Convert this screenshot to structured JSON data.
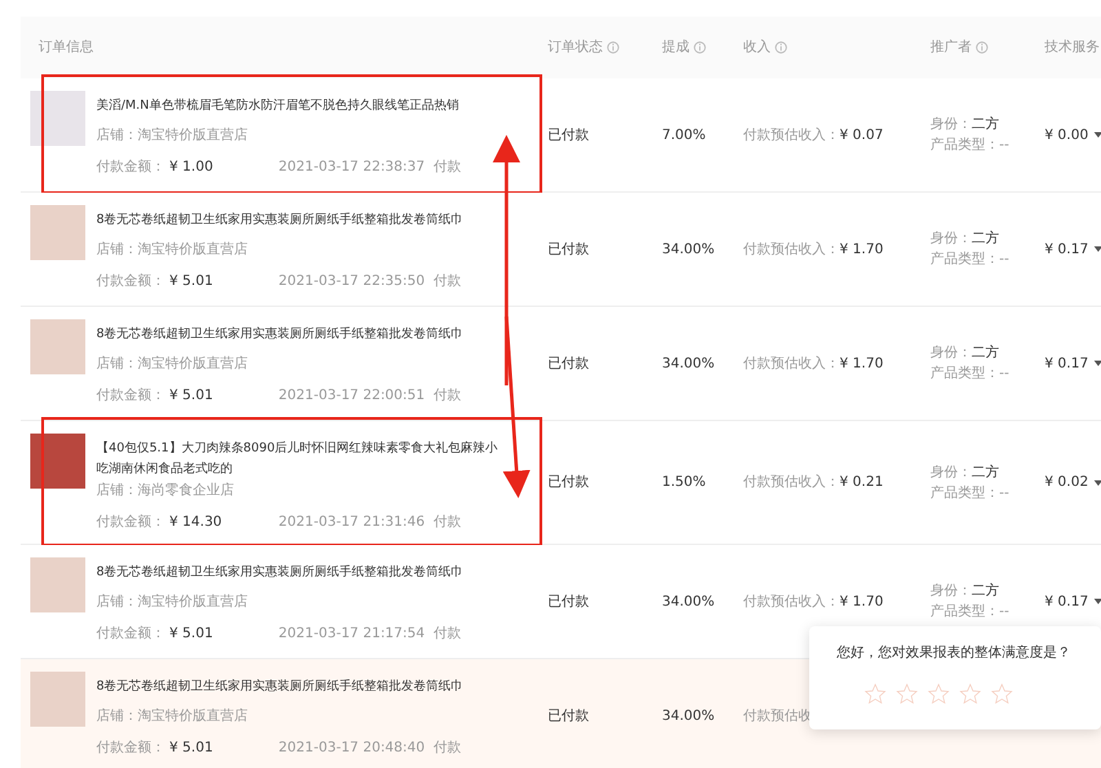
{
  "table": {
    "columns": [
      {
        "label": "订单信息",
        "info": false
      },
      {
        "label": "订单状态",
        "info": true
      },
      {
        "label": "提成",
        "info": true
      },
      {
        "label": "收入",
        "info": true
      },
      {
        "label": "推广者",
        "info": true
      },
      {
        "label": "技术服务",
        "info": false
      }
    ],
    "rows": [
      {
        "title": "美滔/M.N单色带梳眉毛笔防水防汗眉笔不脱色持久眼线笔正品热销",
        "shop": "店铺：淘宝特价版直营店",
        "amount_label": "付款金额：",
        "amount": "¥ 1.00",
        "time": "2021-03-17 22:38:37  付款",
        "status": "已付款",
        "commission": "7.00%",
        "income_label": "付款预估收入：",
        "income": "¥ 0.07",
        "role_label": "身份：",
        "role": "二方",
        "type_label": "产品类型：--",
        "fee": "¥ 0.00",
        "highlighted": true,
        "hovered": false,
        "kind": "pen"
      },
      {
        "title": "8卷无芯卷纸超韧卫生纸家用实惠装厕所厕纸手纸整箱批发卷筒纸巾",
        "shop": "店铺：淘宝特价版直营店",
        "amount_label": "付款金额：",
        "amount": "¥ 5.01",
        "time": "2021-03-17 22:35:50  付款",
        "status": "已付款",
        "commission": "34.00%",
        "income_label": "付款预估收入：",
        "income": "¥ 1.70",
        "role_label": "身份：",
        "role": "二方",
        "type_label": "产品类型：--",
        "fee": "¥ 0.17",
        "highlighted": false,
        "hovered": false,
        "kind": "tissue"
      },
      {
        "title": "8卷无芯卷纸超韧卫生纸家用实惠装厕所厕纸手纸整箱批发卷筒纸巾",
        "shop": "店铺：淘宝特价版直营店",
        "amount_label": "付款金额：",
        "amount": "¥ 5.01",
        "time": "2021-03-17 22:00:51  付款",
        "status": "已付款",
        "commission": "34.00%",
        "income_label": "付款预估收入：",
        "income": "¥ 1.70",
        "role_label": "身份：",
        "role": "二方",
        "type_label": "产品类型：--",
        "fee": "¥ 0.17",
        "highlighted": false,
        "hovered": false,
        "kind": "tissue"
      },
      {
        "title": "【40包仅5.1】大刀肉辣条8090后儿时怀旧网红辣味素零食大礼包麻辣小吃湖南休闲食品老式吃的",
        "shop": "店铺：海尚零食企业店",
        "amount_label": "付款金额：",
        "amount": "¥ 14.30",
        "time": "2021-03-17 21:31:46  付款",
        "status": "已付款",
        "commission": "1.50%",
        "income_label": "付款预估收入：",
        "income": "¥ 0.21",
        "role_label": "身份：",
        "role": "二方",
        "type_label": "产品类型：--",
        "fee": "¥ 0.02",
        "highlighted": true,
        "hovered": false,
        "kind": "snack"
      },
      {
        "title": "8卷无芯卷纸超韧卫生纸家用实惠装厕所厕纸手纸整箱批发卷筒纸巾",
        "shop": "店铺：淘宝特价版直营店",
        "amount_label": "付款金额：",
        "amount": "¥ 5.01",
        "time": "2021-03-17 21:17:54  付款",
        "status": "已付款",
        "commission": "34.00%",
        "income_label": "付款预估收入：",
        "income": "¥ 1.70",
        "role_label": "身份：",
        "role": "二方",
        "type_label": "产品类型：--",
        "fee": "¥ 0.17",
        "highlighted": false,
        "hovered": false,
        "kind": "tissue"
      },
      {
        "title": "8卷无芯卷纸超韧卫生纸家用实惠装厕所厕纸手纸整箱批发卷筒纸巾",
        "shop": "店铺：淘宝特价版直营店",
        "amount_label": "付款金额：",
        "amount": "¥ 5.01",
        "time": "2021-03-17 20:48:40  付款",
        "status": "已付款",
        "commission": "34.00%",
        "income_label": "付款预估收",
        "income": "",
        "role_label": "",
        "role": "",
        "type_label": "",
        "fee": "",
        "highlighted": false,
        "hovered": true,
        "kind": "tissue"
      }
    ]
  },
  "survey": {
    "question": "您好，您对效果报表的整体满意度是？",
    "stars": 0
  }
}
